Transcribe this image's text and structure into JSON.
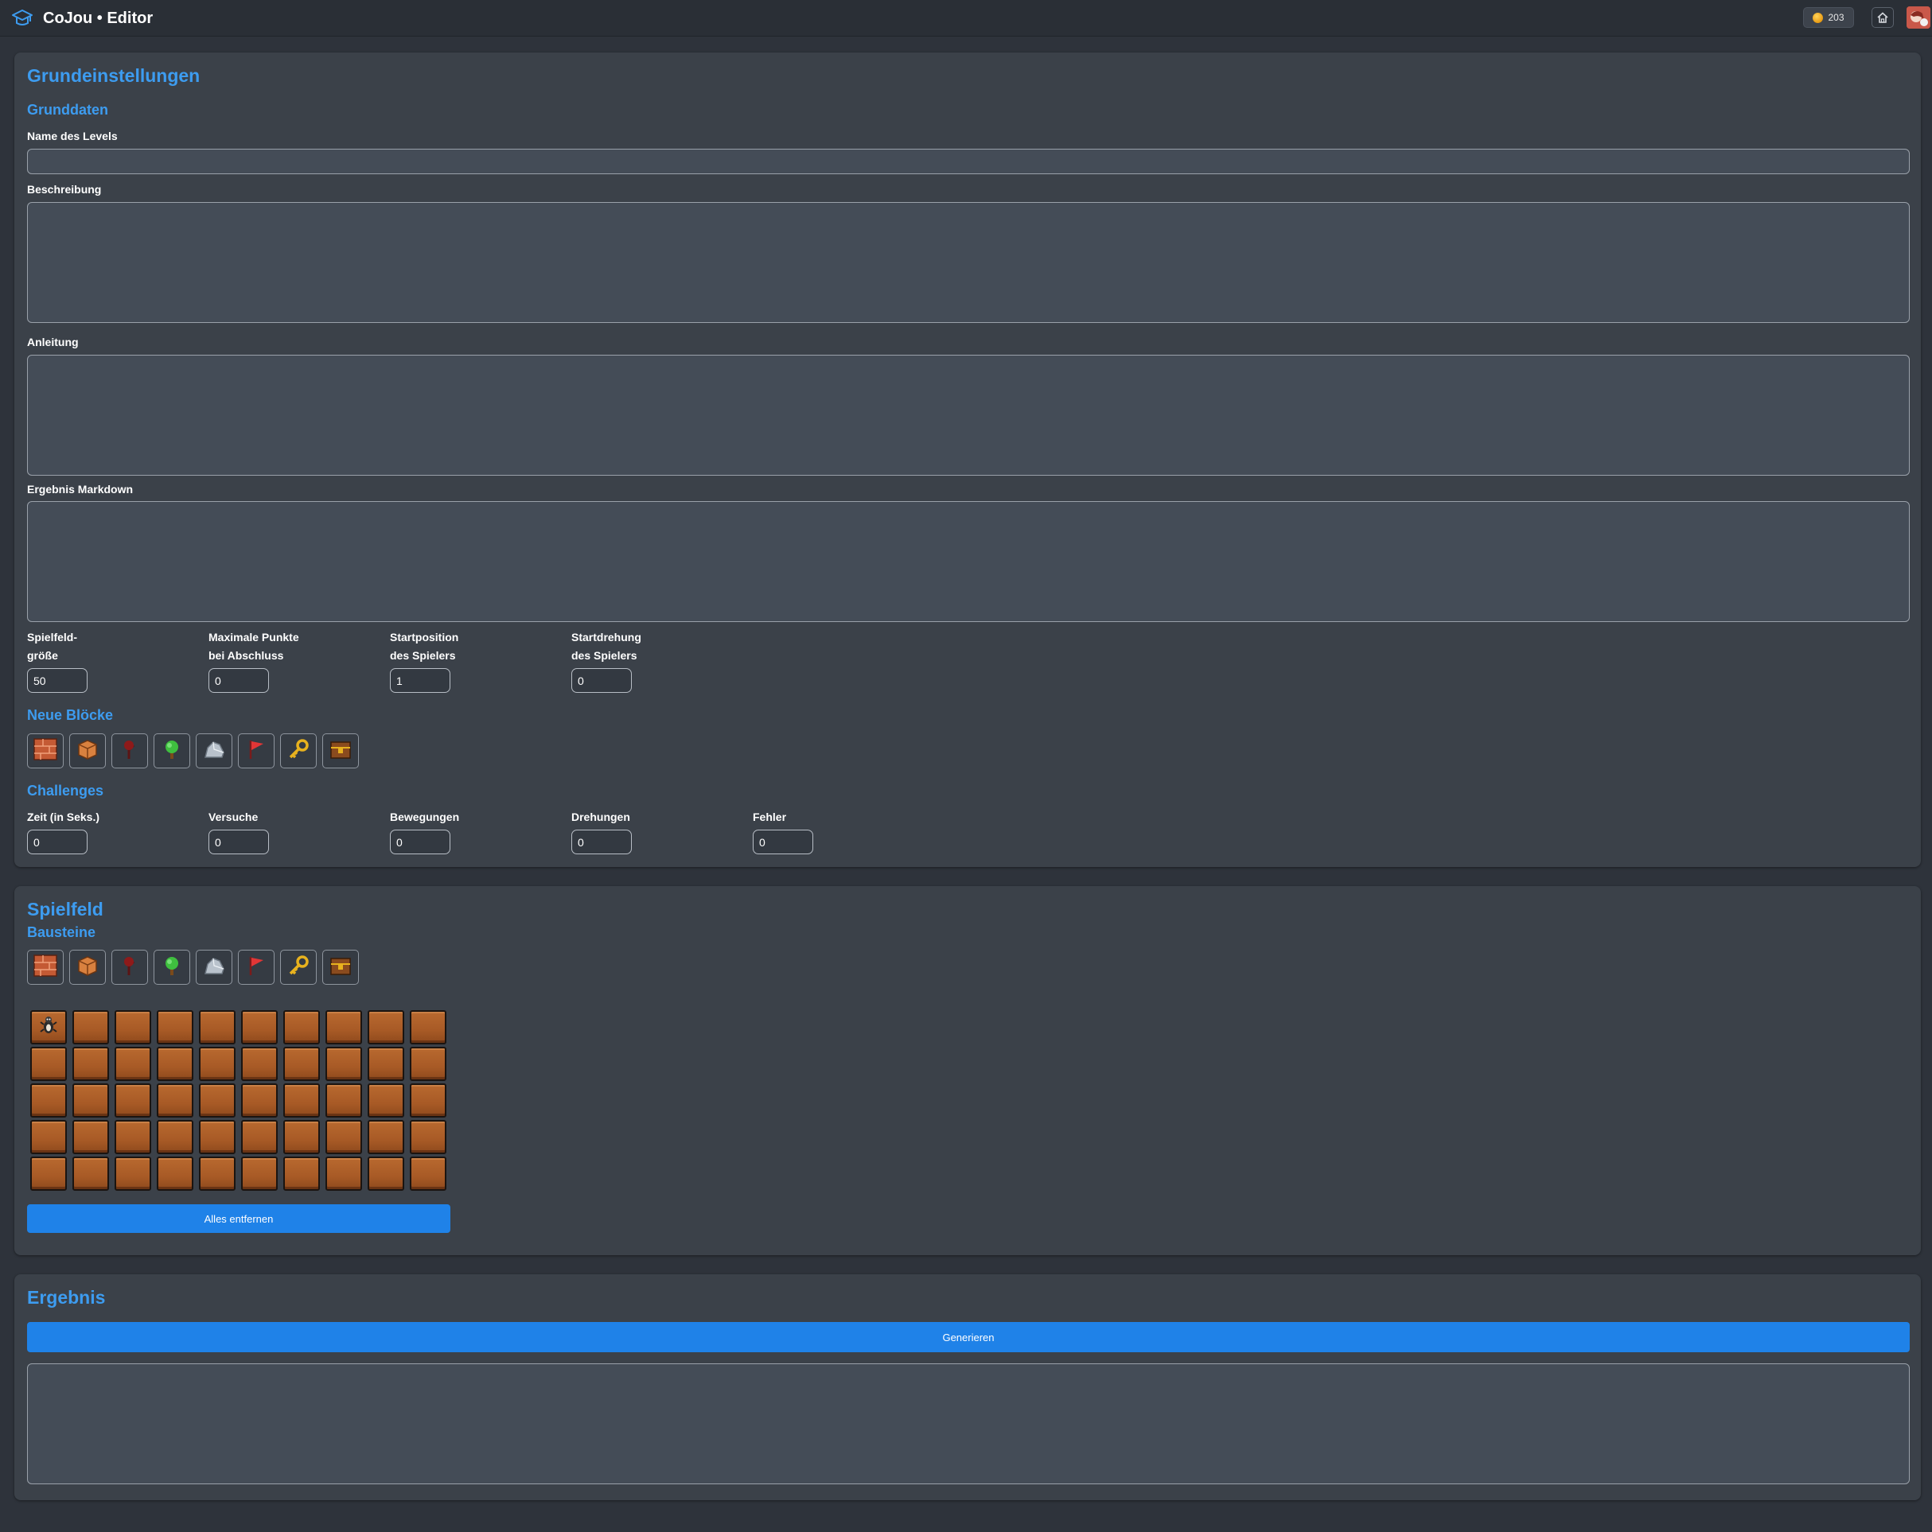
{
  "header": {
    "title": "CoJou • Editor",
    "coins": "203",
    "coin_color": "#f2a51e",
    "icons": [
      "graduation-cap-icon",
      "coin-icon",
      "home-icon",
      "avatar"
    ]
  },
  "settings": {
    "title": "Grundeinstellungen",
    "basic_title": "Grunddaten",
    "name_label": "Name des Levels",
    "name_value": "",
    "description_label": "Beschreibung",
    "description_value": "",
    "instructions_label": "Anleitung",
    "instructions_value": "",
    "result_md_label": "Ergebnis Markdown",
    "result_md_value": "",
    "field_size_label_1": "Spielfeld-",
    "field_size_label_2": "größe",
    "field_size_value": "50",
    "max_points_label_1": "Maximale Punkte",
    "max_points_label_2": "bei Abschluss",
    "max_points_value": "0",
    "start_pos_label_1": "Startposition",
    "start_pos_label_2": "des Spielers",
    "start_pos_value": "1",
    "start_rot_label_1": "Startdrehung",
    "start_rot_label_2": "des Spielers",
    "start_rot_value": "0",
    "new_blocks_title": "Neue Blöcke",
    "challenges_title": "Challenges",
    "challenges": {
      "time_label": "Zeit (in Seks.)",
      "time_value": "0",
      "attempts_label": "Versuche",
      "attempts_value": "0",
      "moves_label": "Bewegungen",
      "moves_value": "0",
      "rotations_label": "Drehungen",
      "rotations_value": "0",
      "errors_label": "Fehler",
      "errors_value": "0"
    }
  },
  "block_types": [
    "brick-wall-icon",
    "crate-icon",
    "dead-tree-icon",
    "tree-icon",
    "rock-icon",
    "flag-icon",
    "key-icon",
    "chest-icon"
  ],
  "field": {
    "title": "Spielfeld",
    "blocks_title": "Bausteine",
    "rows": 5,
    "cols": 10,
    "player_cell": 1,
    "clear_label": "Alles entfernen"
  },
  "result": {
    "title": "Ergebnis",
    "generate_label": "Generieren",
    "output_value": ""
  },
  "colors": {
    "accent": "#3d9cf0",
    "button": "#1f82e8",
    "panel": "#3b4149",
    "background": "#2e333b",
    "tile": "#a85a26"
  }
}
